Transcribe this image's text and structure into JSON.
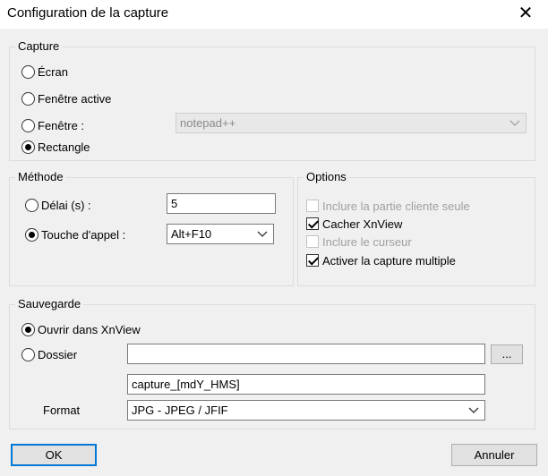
{
  "window": {
    "title": "Configuration de la capture"
  },
  "capture": {
    "legend": "Capture",
    "options": [
      {
        "label": "Écran",
        "checked": false
      },
      {
        "label": "Fenêtre active",
        "checked": false
      },
      {
        "label": "Fenêtre :",
        "checked": false
      },
      {
        "label": "Rectangle",
        "checked": true
      }
    ],
    "window_select": {
      "value": "notepad++",
      "disabled": true
    }
  },
  "methode": {
    "legend": "Méthode",
    "delay_label": "Délai (s) :",
    "delay_value": "5",
    "delay_checked": false,
    "hotkey_label": "Touche d'appel :",
    "hotkey_checked": true,
    "hotkey_value": "Alt+F10"
  },
  "options": {
    "legend": "Options",
    "items": [
      {
        "label": "Inclure la partie cliente seule",
        "checked": false,
        "disabled": true
      },
      {
        "label": "Cacher XnView",
        "checked": true,
        "disabled": false
      },
      {
        "label": "Inclure le curseur",
        "checked": false,
        "disabled": true
      },
      {
        "label": "Activer la capture multiple",
        "checked": true,
        "disabled": false
      }
    ]
  },
  "sauvegarde": {
    "legend": "Sauvegarde",
    "open_label": "Ouvrir dans XnView",
    "open_checked": true,
    "folder_label": "Dossier",
    "folder_checked": false,
    "folder_value": "",
    "browse_label": "...",
    "filename_value": "capture_[mdY_HMS]",
    "format_label": "Format",
    "format_value": "JPG - JPEG / JFIF"
  },
  "buttons": {
    "ok": "OK",
    "cancel": "Annuler"
  }
}
